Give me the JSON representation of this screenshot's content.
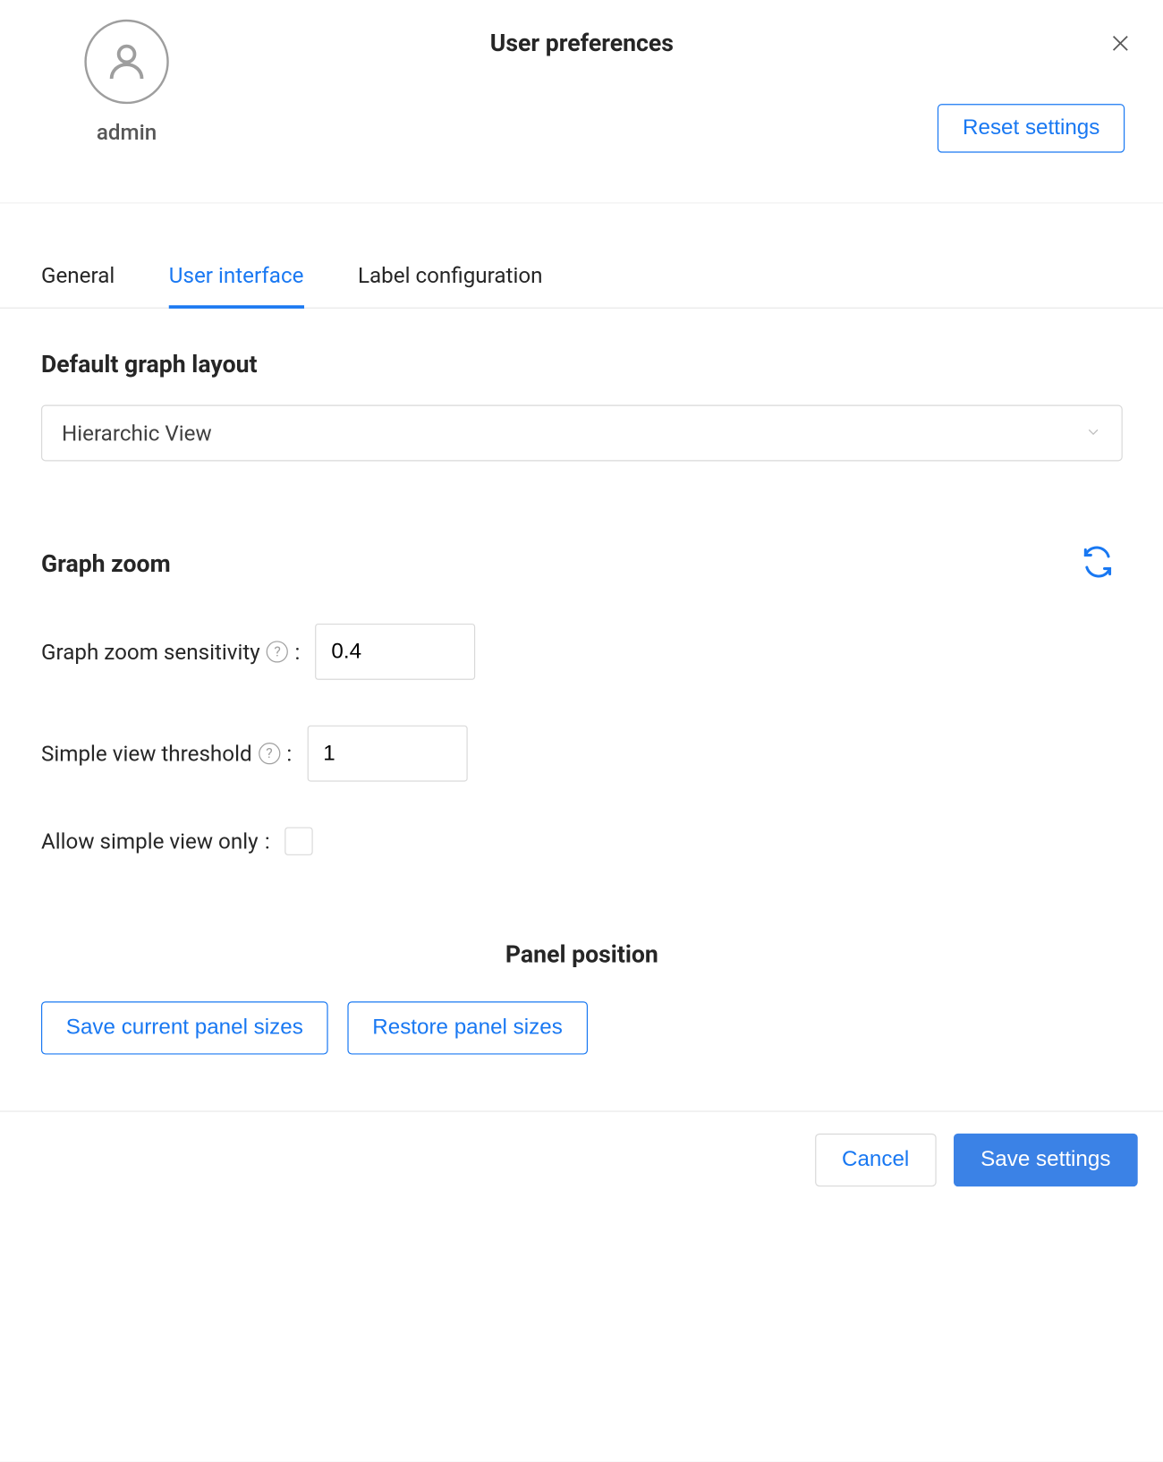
{
  "header": {
    "title": "User preferences",
    "username": "admin",
    "reset_label": "Reset settings"
  },
  "tabs": {
    "general": "General",
    "ui": "User interface",
    "label_config": "Label configuration"
  },
  "default_layout": {
    "title": "Default graph layout",
    "value": "Hierarchic View"
  },
  "zoom": {
    "title": "Graph zoom",
    "sensitivity_label": "Graph zoom sensitivity",
    "sensitivity_value": "0.4",
    "threshold_label": "Simple view threshold",
    "threshold_value": "1",
    "simple_only_label": "Allow simple view only"
  },
  "panel_position": {
    "title": "Panel position",
    "save_label": "Save current panel sizes",
    "restore_label": "Restore panel sizes"
  },
  "footer": {
    "cancel": "Cancel",
    "save": "Save settings"
  }
}
